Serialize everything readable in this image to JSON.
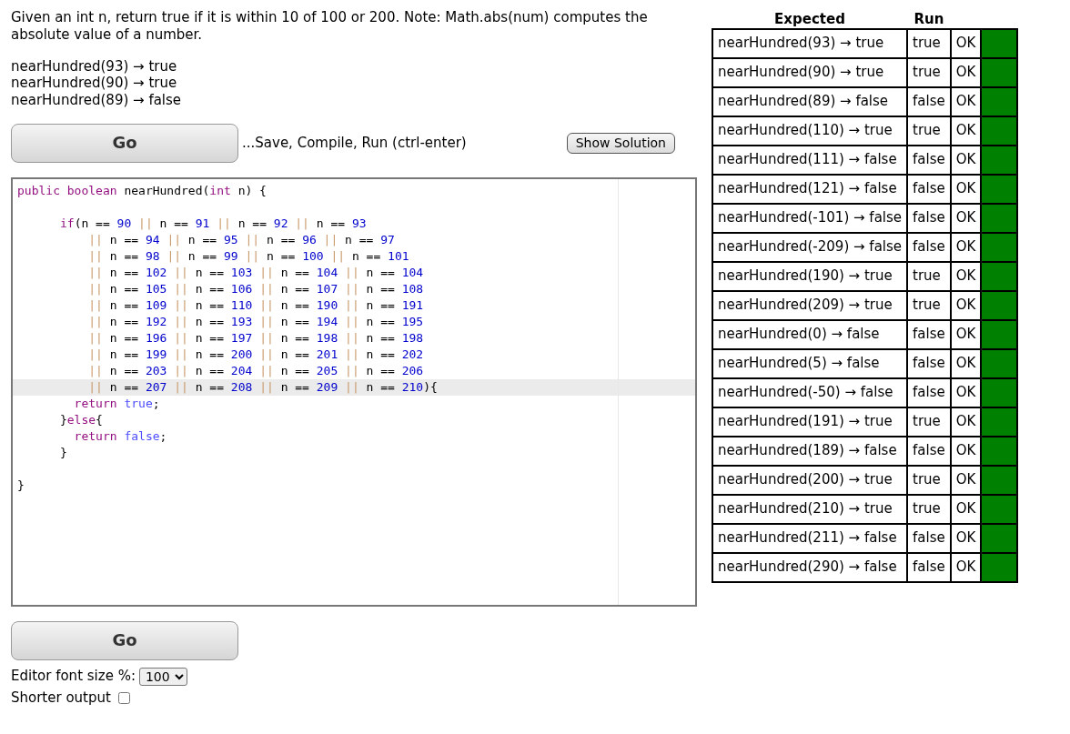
{
  "description": "Given an int n, return true if it is within 10 of 100 or 200. Note: Math.abs(num) computes the absolute value of a number.",
  "examples": [
    "nearHundred(93) → true",
    "nearHundred(90) → true",
    "nearHundred(89) → false"
  ],
  "go_button": "Go",
  "go_button_bottom": "Go",
  "go_hint": "...Save, Compile, Run (ctrl-enter)",
  "solution_button": "Show Solution",
  "editor": {
    "lines": [
      {
        "highlighted": false,
        "segments": [
          {
            "kind": "keyword",
            "text": "public boolean"
          },
          {
            "kind": "plain",
            "text": " nearHundred("
          },
          {
            "kind": "keyword",
            "text": "int"
          },
          {
            "kind": "plain",
            "text": " n) {"
          }
        ]
      },
      {
        "highlighted": false
      },
      {
        "highlighted": false,
        "segments": [
          {
            "kind": "keyword",
            "text": "      if"
          },
          {
            "kind": "plain",
            "text": "(n == 90 || n == 91 || n == 92 || n == 93"
          }
        ]
      },
      {
        "highlighted": false,
        "segments": [
          {
            "kind": "plain",
            "text": "          || n == 94 || n == 95 || n == 96 || n == 97"
          }
        ]
      },
      {
        "highlighted": false,
        "segments": [
          {
            "kind": "plain",
            "text": "          || n == 98 || n == 99 || n == 100 || n == 101"
          }
        ]
      },
      {
        "highlighted": false,
        "segments": [
          {
            "kind": "plain",
            "text": "          || n == 102 || n == 103 || n == 104 || n == 104"
          }
        ]
      },
      {
        "highlighted": false,
        "segments": [
          {
            "kind": "plain",
            "text": "          || n == 105 || n == 106 || n == 107 || n == 108"
          }
        ]
      },
      {
        "highlighted": false,
        "segments": [
          {
            "kind": "plain",
            "text": "          || n == 109 || n == 110 || n == 190 || n == 191"
          }
        ]
      },
      {
        "highlighted": false,
        "segments": [
          {
            "kind": "plain",
            "text": "          || n == 192 || n == 193 || n == 194 || n == 195"
          }
        ]
      },
      {
        "highlighted": false,
        "segments": [
          {
            "kind": "plain",
            "text": "          || n == 196 || n == 197 || n == 198 || n == 198"
          }
        ]
      },
      {
        "highlighted": false,
        "segments": [
          {
            "kind": "plain",
            "text": "          || n == 199 || n == 200 || n == 201 || n == 202"
          }
        ]
      },
      {
        "highlighted": false,
        "segments": [
          {
            "kind": "plain",
            "text": "          || n == 203 || n == 204 || n == 205 || n == 206"
          }
        ]
      },
      {
        "highlighted": true,
        "segments": [
          {
            "kind": "plain",
            "text": "          || n == 207 || n == 208 || n == 209 || n == 210){"
          }
        ]
      },
      {
        "highlighted": false,
        "segments": [
          {
            "kind": "keyword",
            "text": "        return"
          },
          {
            "kind": "literal",
            "text": " true"
          },
          {
            "kind": "plain",
            "text": ";"
          }
        ]
      },
      {
        "highlighted": false,
        "segments": [
          {
            "kind": "plain",
            "text": "      }"
          },
          {
            "kind": "keyword",
            "text": "else"
          },
          {
            "kind": "plain",
            "text": "{"
          }
        ]
      },
      {
        "highlighted": false,
        "segments": [
          {
            "kind": "keyword",
            "text": "        return"
          },
          {
            "kind": "literal",
            "text": " false"
          },
          {
            "kind": "plain",
            "text": ";"
          }
        ]
      },
      {
        "highlighted": false,
        "segments": [
          {
            "kind": "plain",
            "text": "      }"
          }
        ]
      },
      {
        "highlighted": false
      },
      {
        "highlighted": false,
        "segments": [
          {
            "kind": "plain",
            "text": "}"
          }
        ]
      }
    ]
  },
  "font_size_label": "Editor font size %:",
  "font_size_value": "100",
  "shorter_output_label": "Shorter output",
  "shorter_output_checked": false,
  "results": {
    "columns": [
      "Expected",
      "Run"
    ],
    "rows": [
      {
        "expected": "nearHundred(93) → true",
        "run": "true",
        "status": "OK",
        "color": "#008000"
      },
      {
        "expected": "nearHundred(90) → true",
        "run": "true",
        "status": "OK",
        "color": "#008000"
      },
      {
        "expected": "nearHundred(89) → false",
        "run": "false",
        "status": "OK",
        "color": "#008000"
      },
      {
        "expected": "nearHundred(110) → true",
        "run": "true",
        "status": "OK",
        "color": "#008000"
      },
      {
        "expected": "nearHundred(111) → false",
        "run": "false",
        "status": "OK",
        "color": "#008000"
      },
      {
        "expected": "nearHundred(121) → false",
        "run": "false",
        "status": "OK",
        "color": "#008000"
      },
      {
        "expected": "nearHundred(-101) → false",
        "run": "false",
        "status": "OK",
        "color": "#008000"
      },
      {
        "expected": "nearHundred(-209) → false",
        "run": "false",
        "status": "OK",
        "color": "#008000"
      },
      {
        "expected": "nearHundred(190) → true",
        "run": "true",
        "status": "OK",
        "color": "#008000"
      },
      {
        "expected": "nearHundred(209) → true",
        "run": "true",
        "status": "OK",
        "color": "#008000"
      },
      {
        "expected": "nearHundred(0) → false",
        "run": "false",
        "status": "OK",
        "color": "#008000"
      },
      {
        "expected": "nearHundred(5) → false",
        "run": "false",
        "status": "OK",
        "color": "#008000"
      },
      {
        "expected": "nearHundred(-50) → false",
        "run": "false",
        "status": "OK",
        "color": "#008000"
      },
      {
        "expected": "nearHundred(191) → true",
        "run": "true",
        "status": "OK",
        "color": "#008000"
      },
      {
        "expected": "nearHundred(189) → false",
        "run": "false",
        "status": "OK",
        "color": "#008000"
      },
      {
        "expected": "nearHundred(200) → true",
        "run": "true",
        "status": "OK",
        "color": "#008000"
      },
      {
        "expected": "nearHundred(210) → true",
        "run": "true",
        "status": "OK",
        "color": "#008000"
      },
      {
        "expected": "nearHundred(211) → false",
        "run": "false",
        "status": "OK",
        "color": "#008000"
      },
      {
        "expected": "nearHundred(290) → false",
        "run": "false",
        "status": "OK",
        "color": "#008000"
      }
    ]
  }
}
